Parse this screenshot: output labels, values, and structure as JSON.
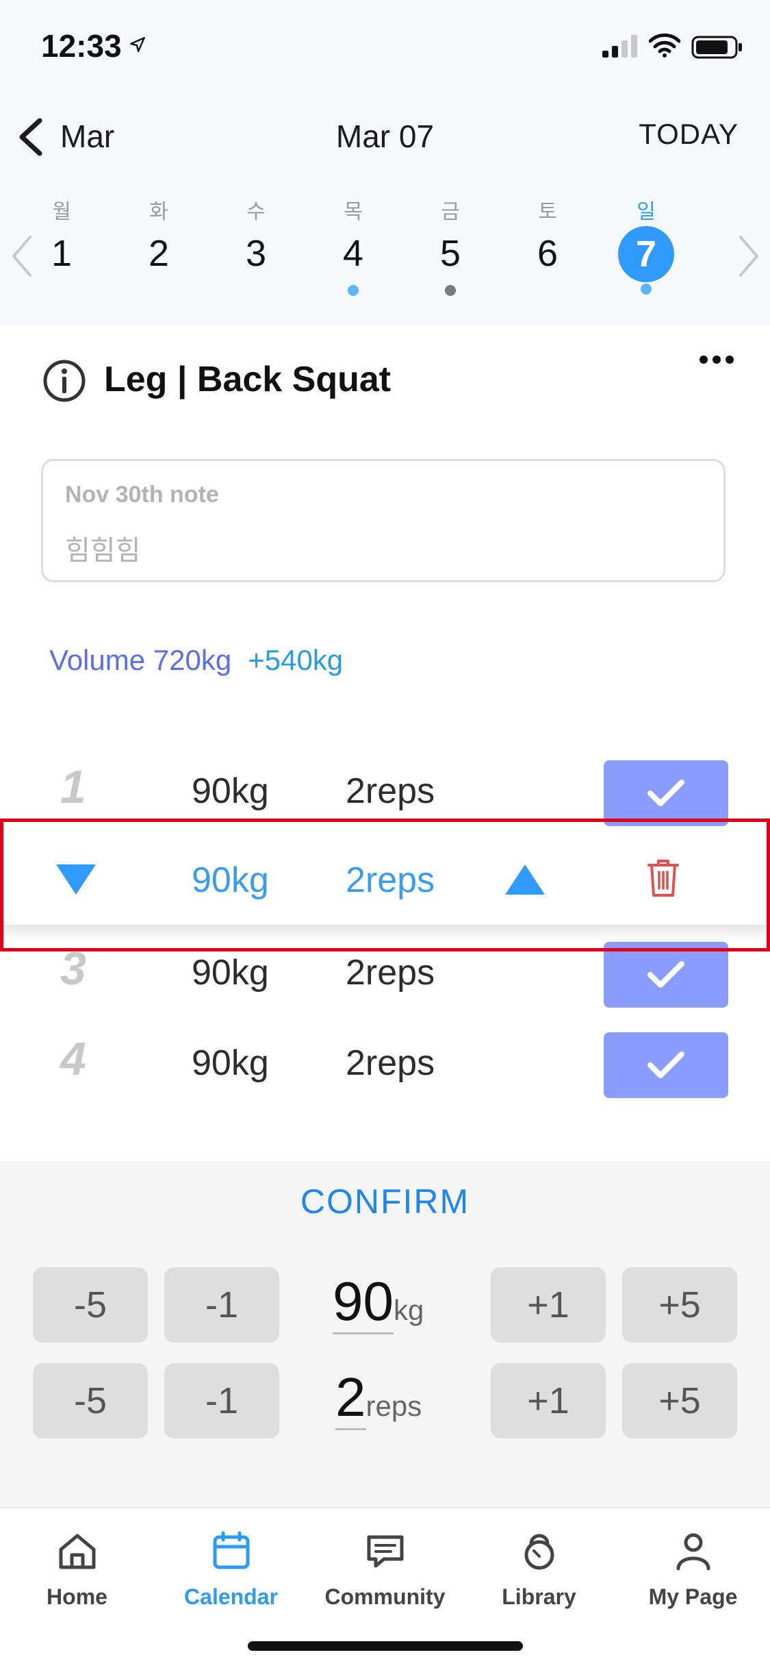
{
  "status_bar": {
    "time": "12:33"
  },
  "nav": {
    "back_label": "Mar",
    "title": "Mar 07",
    "today_label": "TODAY"
  },
  "week": {
    "days": [
      {
        "name": "월",
        "date": "1",
        "dot": ""
      },
      {
        "name": "화",
        "date": "2",
        "dot": ""
      },
      {
        "name": "수",
        "date": "3",
        "dot": ""
      },
      {
        "name": "목",
        "date": "4",
        "dot": "#5ab6f5"
      },
      {
        "name": "금",
        "date": "5",
        "dot": "#7a7a7a"
      },
      {
        "name": "토",
        "date": "6",
        "dot": ""
      },
      {
        "name": "일",
        "date": "7",
        "dot": "#5ab6f5",
        "selected": true
      }
    ]
  },
  "exercise": {
    "title": "Leg | Back Squat"
  },
  "note": {
    "label": "Nov 30th  note",
    "text": "힘힘힘"
  },
  "volume": {
    "total": "Volume 720kg",
    "delta": "+540kg"
  },
  "sets": [
    {
      "num": "1",
      "weight": "90kg",
      "reps": "2reps"
    },
    {
      "num": "3",
      "weight": "90kg",
      "reps": "2reps"
    },
    {
      "num": "4",
      "weight": "90kg",
      "reps": "2reps"
    }
  ],
  "edit_set": {
    "weight": "90kg",
    "reps": "2reps"
  },
  "panel": {
    "confirm": "CONFIRM",
    "weight": {
      "minus5": "-5",
      "minus1": "-1",
      "value": "90",
      "unit": "kg",
      "plus1": "+1",
      "plus5": "+5"
    },
    "reps": {
      "minus5": "-5",
      "minus1": "-1",
      "value": "2",
      "unit": "reps",
      "plus1": "+1",
      "plus5": "+5"
    }
  },
  "tabs": [
    {
      "label": "Home",
      "icon": "home-icon"
    },
    {
      "label": "Calendar",
      "icon": "calendar-icon",
      "active": true
    },
    {
      "label": "Community",
      "icon": "chat-icon"
    },
    {
      "label": "Library",
      "icon": "kettlebell-icon"
    },
    {
      "label": "My Page",
      "icon": "person-icon"
    }
  ],
  "colors": {
    "accent": "#2f9bff",
    "check": "#8b9cff",
    "delete": "#e05050",
    "highlight": "#e3001b"
  }
}
